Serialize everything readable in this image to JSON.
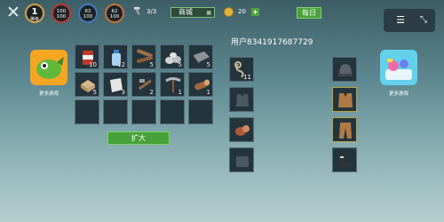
{
  "hud": {
    "close_icon": "close-icon",
    "level": {
      "value": "1",
      "label": "等级"
    },
    "stats": [
      {
        "name": "health",
        "top": "100",
        "bottom": "100",
        "color": "#c0392b"
      },
      {
        "name": "water",
        "top": "62",
        "bottom": "100",
        "color": "#3f7ac0"
      },
      {
        "name": "food",
        "top": "62",
        "bottom": "100",
        "color": "#c8743a"
      }
    ],
    "build_counter": "3/3",
    "shop_label": "商城",
    "coins": "20",
    "coin_add": "+",
    "daily_label": "每日",
    "menu_icon": "menu-icon",
    "collapse_icon": "collapse-icon"
  },
  "promo_left": {
    "label": "更多游戏"
  },
  "promo_right": {
    "label": "更多游戏"
  },
  "inventory": {
    "slots": [
      {
        "item": "soda-can",
        "count": "10"
      },
      {
        "item": "water-bottle",
        "count": "12"
      },
      {
        "item": "wood-planks",
        "count": "5"
      },
      {
        "item": "stones",
        "count": "5"
      },
      {
        "item": "metal-plate",
        "count": "5"
      },
      {
        "item": "fishing-box",
        "count": "5"
      },
      {
        "item": "cloth",
        "count": "3"
      },
      {
        "item": "tools",
        "count": "2"
      },
      {
        "item": "pickaxe",
        "count": "1"
      },
      {
        "item": "log",
        "count": "1"
      },
      {
        "item": "",
        "count": ""
      },
      {
        "item": "",
        "count": ""
      },
      {
        "item": "",
        "count": ""
      },
      {
        "item": "",
        "count": ""
      },
      {
        "item": "",
        "count": ""
      }
    ],
    "expand_label": "扩大"
  },
  "player": {
    "name": "用户8341917687729",
    "hand_slots": [
      {
        "item": "rope",
        "count": "11"
      },
      {
        "item": "vest-slot",
        "count": ""
      },
      {
        "item": "meat",
        "count": ""
      },
      {
        "item": "boots-slot",
        "count": ""
      }
    ],
    "equipment": [
      {
        "item": "beanie"
      },
      {
        "item": "leather-vest"
      },
      {
        "item": "leather-pants"
      },
      {
        "item": "boots"
      }
    ]
  }
}
